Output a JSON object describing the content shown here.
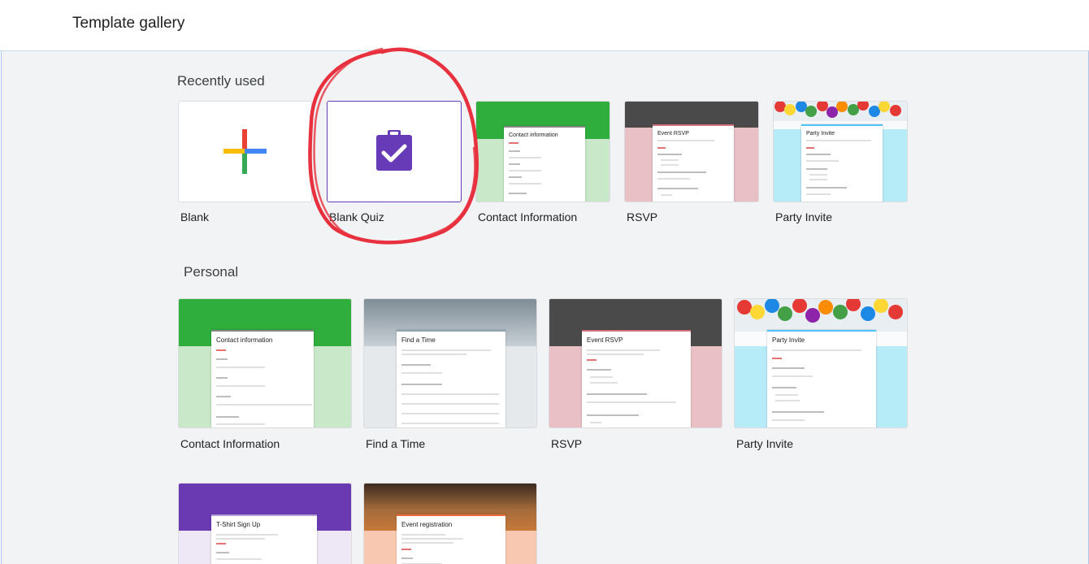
{
  "header": {
    "title": "Template gallery"
  },
  "sections": {
    "recent": {
      "title": "Recently used",
      "cards": [
        {
          "label": "Blank"
        },
        {
          "label": "Blank Quiz"
        },
        {
          "label": "Contact Information",
          "form_title": "Contact information"
        },
        {
          "label": "RSVP",
          "form_title": "Event RSVP"
        },
        {
          "label": "Party Invite",
          "form_title": "Party Invite"
        }
      ]
    },
    "personal": {
      "title": "Personal",
      "cards": [
        {
          "label": "Contact Information",
          "form_title": "Contact information"
        },
        {
          "label": "Find a Time",
          "form_title": "Find a Time"
        },
        {
          "label": "RSVP",
          "form_title": "Event RSVP"
        },
        {
          "label": "Party Invite",
          "form_title": "Party Invite"
        },
        {
          "label": "",
          "form_title": "T-Shirt Sign Up"
        },
        {
          "label": "",
          "form_title": "Event registration"
        }
      ]
    }
  },
  "icons": {
    "blank": "plus-icon",
    "quiz": "quiz-clipboard-icon"
  },
  "colors": {
    "quiz_purple": "#673ab7",
    "annotation_red": "#e8313f",
    "contact_green": "#2fae3d",
    "contact_bg": "#c9e7c9",
    "rsvp_bg": "#e8c0c6",
    "party_bg": "#b6ebf8",
    "findtime_bg": "#e6e9ec",
    "tshirt_purple": "#6a3ab2",
    "tshirt_bg": "#ede7f6",
    "event_bg": "#f8c8b0"
  }
}
